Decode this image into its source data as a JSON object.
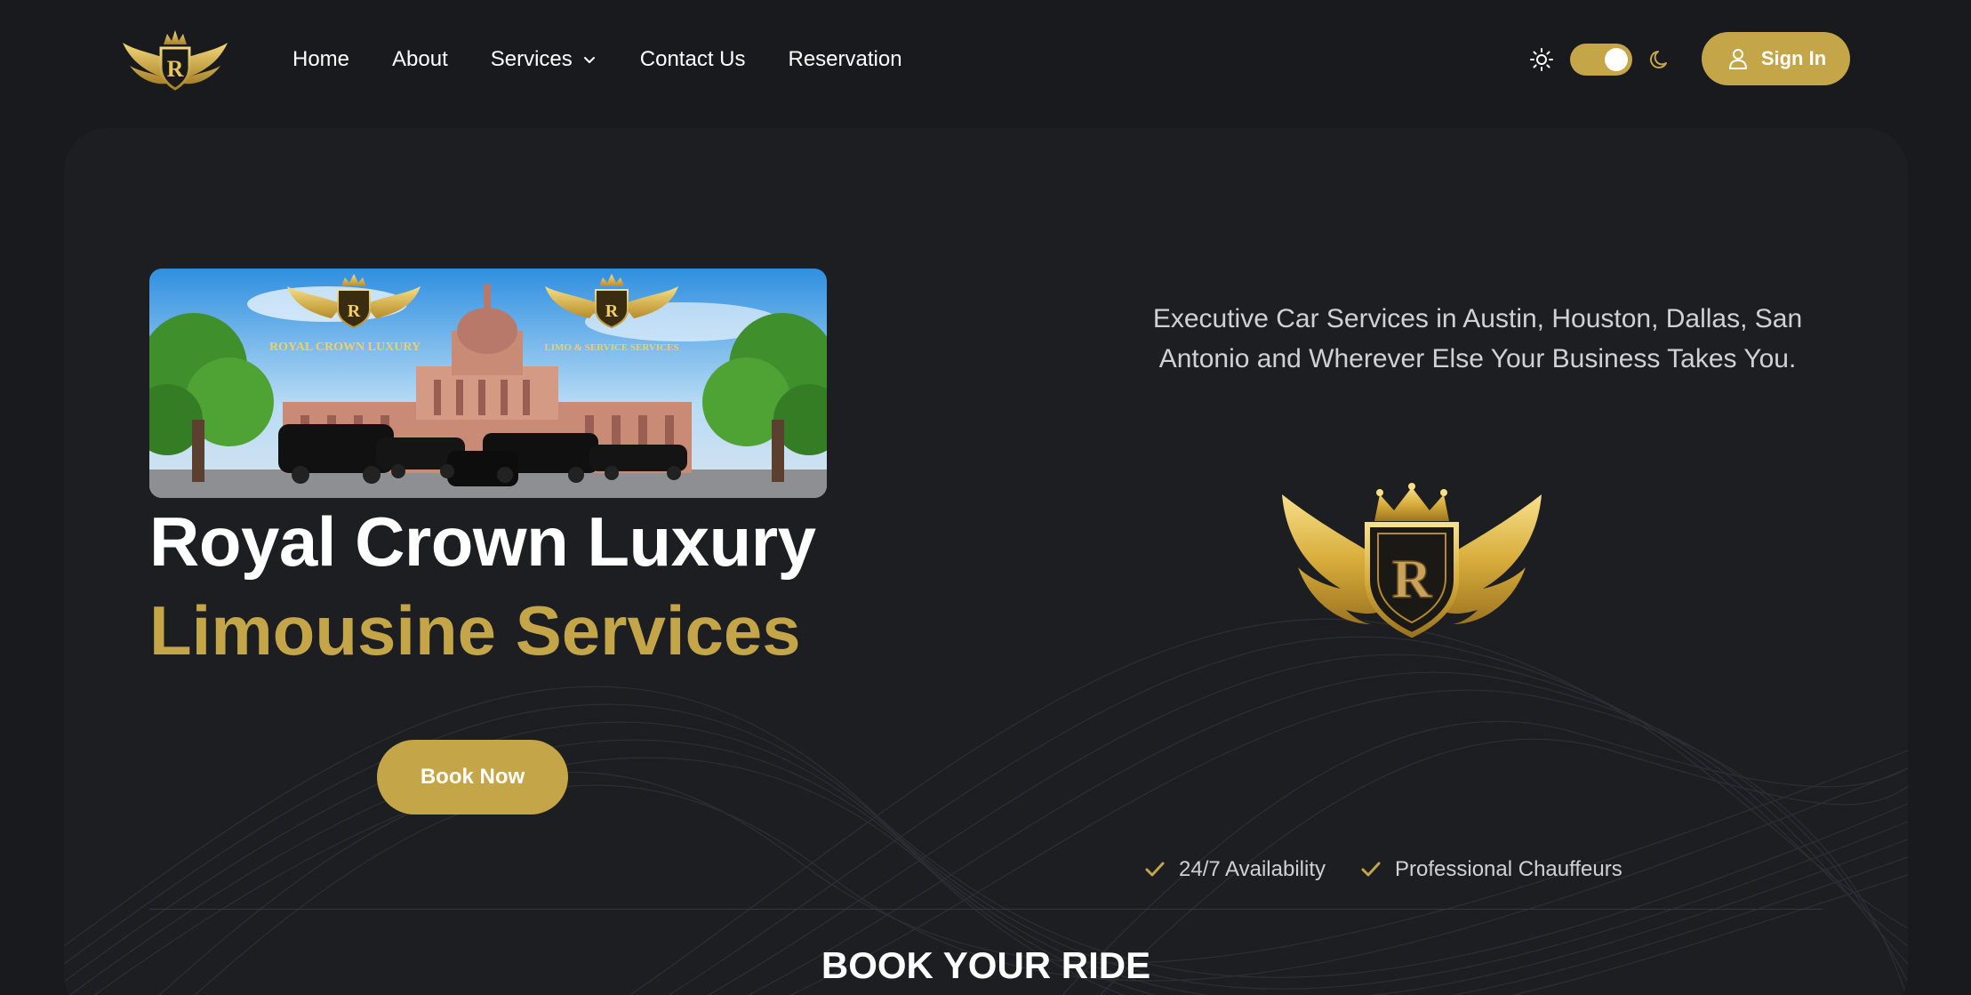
{
  "brand": {
    "name": "Royal Crown Luxury",
    "logo_icon": "royal-crown-winged-shield-logo",
    "logo_letter": "R"
  },
  "nav": {
    "items": [
      {
        "label": "Home"
      },
      {
        "label": "About"
      },
      {
        "label": "Services",
        "has_dropdown": true
      },
      {
        "label": "Contact Us"
      },
      {
        "label": "Reservation"
      }
    ]
  },
  "theme_toggle": {
    "light_icon": "sun-icon",
    "dark_icon": "moon-icon",
    "state": "dark"
  },
  "auth": {
    "signin_label": "Sign In",
    "signin_icon": "user-icon"
  },
  "hero": {
    "banner": {
      "logo_left_text": "ROYAL CROWN LUXURY",
      "logo_right_text": "LIMO & SERVICE SERVICES"
    },
    "title_line1": "Royal Crown Luxury",
    "title_line2": "Limousine Services",
    "cta_label": "Book Now",
    "tagline": "Executive Car Services in Austin, Houston, Dallas, San Antonio and Wherever Else Your Business Takes You.",
    "features": [
      {
        "label": "24/7 Availability",
        "icon": "check-icon"
      },
      {
        "label": "Professional Chauffeurs",
        "icon": "check-icon"
      }
    ]
  },
  "booking": {
    "heading": "BOOK YOUR RIDE"
  },
  "colors": {
    "background": "#181a1d",
    "card": "#1c1e22",
    "accent_gold": "#c4a548",
    "text": "#ffffff",
    "muted_text": "#cfd1d4"
  }
}
